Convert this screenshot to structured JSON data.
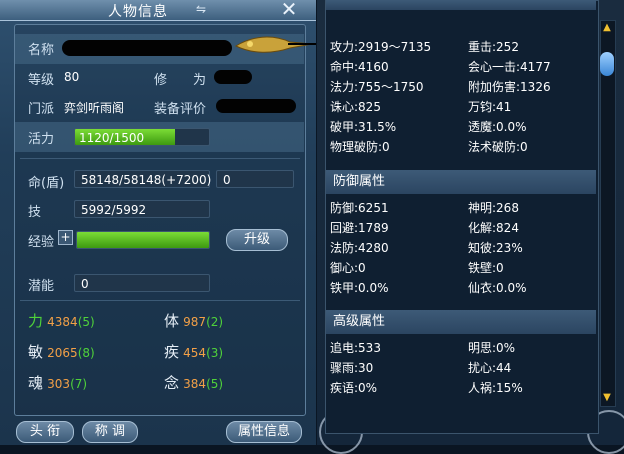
{
  "window": {
    "title": "人物信息",
    "title_icon": "⇋",
    "close_glyph": "✕"
  },
  "character": {
    "name_label": "名称",
    "level_label": "等级",
    "level_value": "80",
    "cultivation_label": "修　　为",
    "sect_label": "门派",
    "sect_value": "弈剑听雨阁",
    "gear_label": "装备评价",
    "vitality_label": "活力",
    "vitality_value": "1120/1500",
    "vitality_fraction": 0.7467,
    "hp_label": "命(盾)",
    "hp_value": "58148/58148(+7200)",
    "shield_value": "0",
    "skill_label": "技",
    "skill_value": "5992/5992",
    "exp_label": "经验",
    "exp_plus": "+",
    "exp_fraction": 1.0,
    "upgrade_label": "升级",
    "potential_label": "潜能",
    "potential_value": "0"
  },
  "attributes": [
    {
      "label": "力",
      "value": "4384",
      "bonus": "(5)"
    },
    {
      "label": "体",
      "value": "987",
      "bonus": "(2)"
    },
    {
      "label": "敏",
      "value": "2065",
      "bonus": "(8)"
    },
    {
      "label": "疾",
      "value": "454",
      "bonus": "(3)"
    },
    {
      "label": "魂",
      "value": "303",
      "bonus": "(7)"
    },
    {
      "label": "念",
      "value": "384",
      "bonus": "(5)"
    }
  ],
  "footer": {
    "title_button": "头 衔",
    "nickname_button": "称 调",
    "attr_info_button": "属性信息"
  },
  "right_panel": {
    "top_rows": [
      [
        "攻力:2919～7135",
        "重击:252"
      ],
      [
        "命中:4160",
        "会心一击:4177"
      ],
      [
        "法力:755～1750",
        "附加伤害:1326"
      ],
      [
        "诛心:825",
        "万钧:41"
      ],
      [
        "破甲:31.5%",
        "透魔:0.0%"
      ],
      [
        "物理破防:0",
        "法术破防:0"
      ]
    ],
    "defense_heading": "防御属性",
    "defense_rows": [
      [
        "防御:6251",
        "神明:268"
      ],
      [
        "回避:1789",
        "化解:824"
      ],
      [
        "法防:4280",
        "知彼:23%"
      ],
      [
        "御心:0",
        "铁壁:0"
      ],
      [
        "铁甲:0.0%",
        "仙衣:0.0%"
      ]
    ],
    "advanced_heading": "高级属性",
    "advanced_rows": [
      [
        "追电:533",
        "明思:0%"
      ],
      [
        "骤雨:30",
        "扰心:44"
      ],
      [
        "疾语:0%",
        "人祸:15%"
      ]
    ],
    "scroll_up": "▲",
    "scroll_down": "▼"
  },
  "colors": {
    "accent_green": "#4fd23a",
    "accent_orange": "#f2a047",
    "scroll_arrow": "#f0c030"
  }
}
